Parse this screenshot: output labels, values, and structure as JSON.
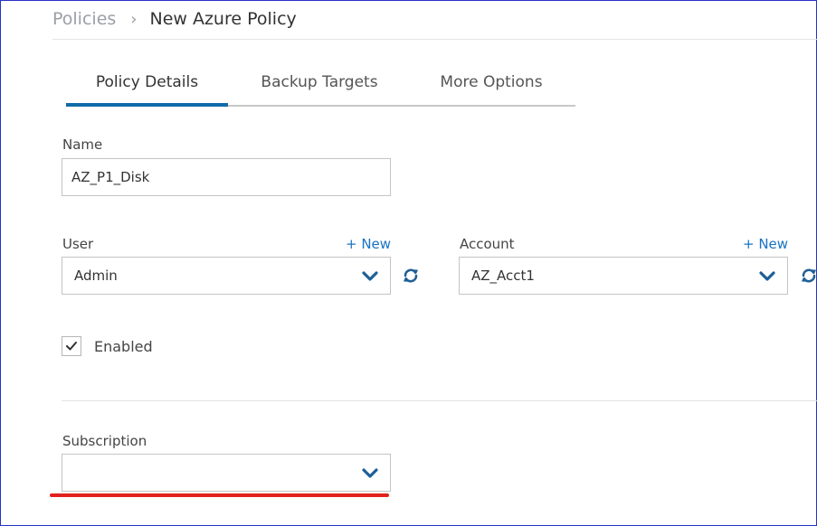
{
  "breadcrumb": {
    "root": "Policies",
    "separator": "›",
    "current": "New Azure Policy"
  },
  "tabs": [
    {
      "label": "Policy Details",
      "active": true
    },
    {
      "label": "Backup Targets",
      "active": false
    },
    {
      "label": "More Options",
      "active": false
    }
  ],
  "form": {
    "name": {
      "label": "Name",
      "value": "AZ_P1_Disk"
    },
    "user": {
      "label": "User",
      "new_link": "+ New",
      "value": "Admin"
    },
    "account": {
      "label": "Account",
      "new_link": "+ New",
      "value": "AZ_Acct1"
    },
    "enabled": {
      "label": "Enabled",
      "checked": true
    },
    "subscription": {
      "label": "Subscription",
      "value": ""
    }
  },
  "colors": {
    "accent": "#0f6aa8",
    "link": "#1a73c4",
    "annotation_red": "#e2201d",
    "frame_border": "#2633c9"
  },
  "icons": {
    "select_arrow": "chevron-down-icon",
    "reload": "refresh-icon",
    "check": "checkmark-icon"
  }
}
